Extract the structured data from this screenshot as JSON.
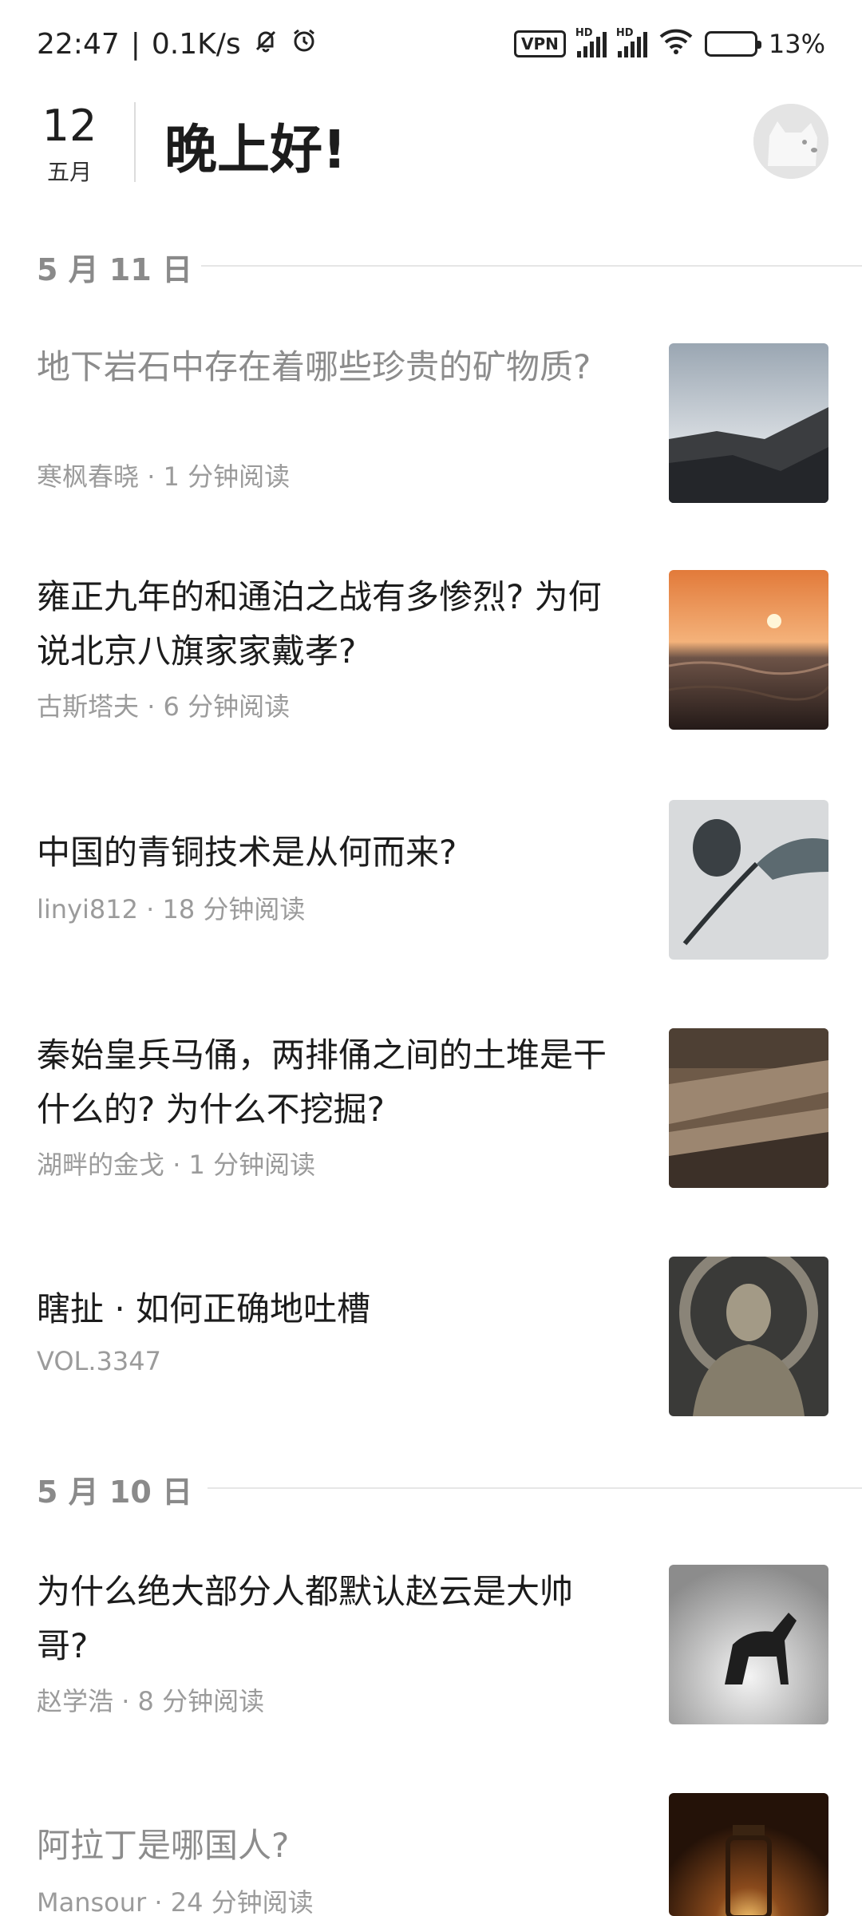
{
  "status_bar": {
    "time": "22:47",
    "separator": "|",
    "net_speed": "0.1K/s",
    "vpn_label": "VPN",
    "hd_label_1": "HD",
    "hd_label_2": "HD",
    "battery_percent": "13%",
    "battery_level": 0.13,
    "icons": [
      "bell-muted-icon",
      "alarm-icon",
      "vpn-icon",
      "signal-icon",
      "signal-icon",
      "wifi-icon",
      "battery-icon"
    ]
  },
  "header": {
    "day": "12",
    "month": "五月",
    "greeting": "晚上好!"
  },
  "sections": [
    {
      "label": "5 月 11 日"
    },
    {
      "label": "5 月 10 日"
    }
  ],
  "articles": [
    {
      "title": "地下岩石中存在着哪些珍贵的矿物质?",
      "author": "寒枫春晓",
      "sep": "·",
      "read_time": "1 分钟阅读",
      "read": true,
      "thumb": "rocky-coast"
    },
    {
      "title": "雍正九年的和通泊之战有多惨烈? 为何说北京八旗家家戴孝?",
      "author": "古斯塔夫",
      "sep": "·",
      "read_time": "6 分钟阅读",
      "read": false,
      "thumb": "sunset-sea"
    },
    {
      "title": "中国的青铜技术是从何而来?",
      "author": "linyi812",
      "sep": "·",
      "read_time": "18 分钟阅读",
      "read": false,
      "thumb": "bronze-rose"
    },
    {
      "title": "秦始皇兵马俑，两排俑之间的土堆是干什么的? 为什么不挖掘?",
      "author": "湖畔的金戈",
      "sep": "·",
      "read_time": "1 分钟阅读",
      "read": false,
      "thumb": "terracotta-army"
    },
    {
      "title": "瞎扯 · 如何正确地吐槽",
      "author": "VOL.3347",
      "sep": "",
      "read_time": "",
      "read": false,
      "thumb": "statue"
    },
    {
      "title": "为什么绝大部分人都默认赵云是大帅哥?",
      "author": "赵学浩",
      "sep": "·",
      "read_time": "8 分钟阅读",
      "read": false,
      "thumb": "horse"
    },
    {
      "title": "阿拉丁是哪国人?",
      "author": "Mansour",
      "sep": "·",
      "read_time": "24 分钟阅读",
      "read": true,
      "thumb": "lantern"
    }
  ]
}
